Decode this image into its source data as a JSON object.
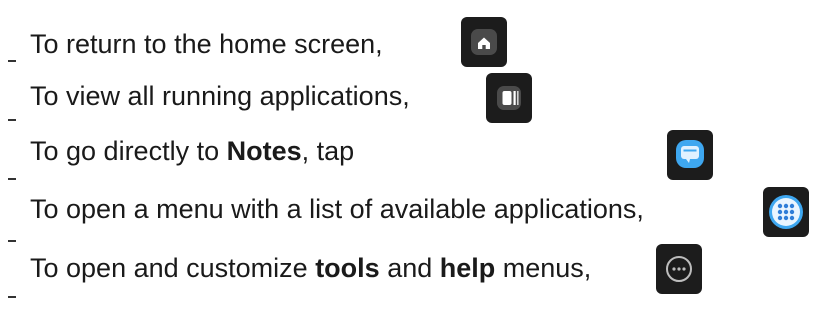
{
  "instructions": [
    {
      "text_before": "To return to the home screen,",
      "bold_1": "",
      "text_mid": "",
      "bold_2": "",
      "text_after": "",
      "icon": "home-icon"
    },
    {
      "text_before": "To view all running applications,",
      "bold_1": "",
      "text_mid": "",
      "bold_2": "",
      "text_after": "",
      "icon": "recent-apps-icon"
    },
    {
      "text_before": "To go directly to ",
      "bold_1": "Notes",
      "text_mid": ", tap",
      "bold_2": "",
      "text_after": "",
      "icon": "notes-icon"
    },
    {
      "text_before": "To open a menu with a list of available applications,",
      "bold_1": "",
      "text_mid": "",
      "bold_2": "",
      "text_after": "",
      "icon": "app-drawer-icon"
    },
    {
      "text_before": "To open and customize ",
      "bold_1": "tools",
      "text_mid": " and ",
      "bold_2": "help",
      "text_after": " menus,",
      "icon": "more-options-icon"
    }
  ],
  "colors": {
    "icon_dark_bg": "#1c1c1c",
    "icon_light_blue": "#3ea7f0",
    "icon_white": "#ffffff"
  }
}
